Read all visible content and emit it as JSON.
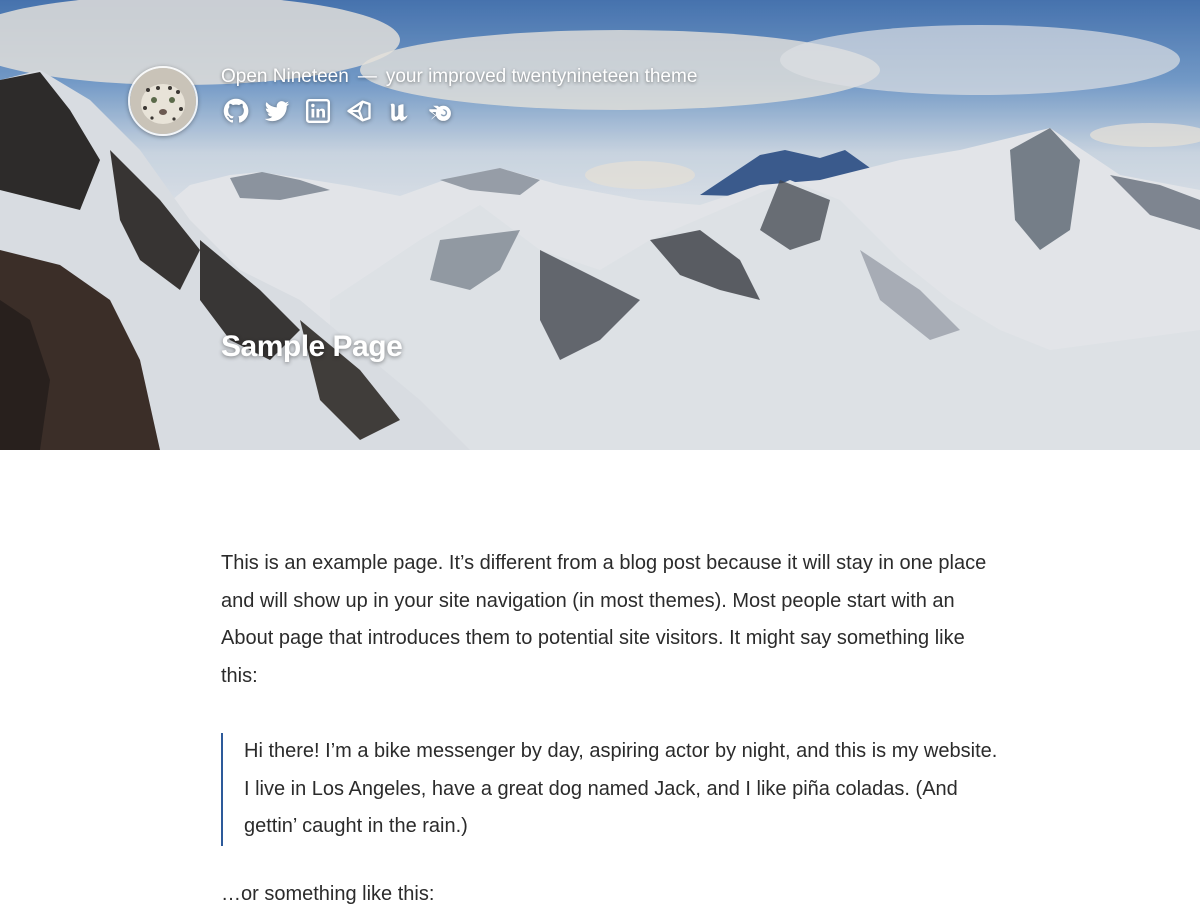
{
  "header": {
    "site_title": "Open Nineteen",
    "separator": "—",
    "tagline": "your improved twentynineteen theme",
    "avatar_icon": "snow-leopard-avatar",
    "social_links": [
      {
        "name": "github-icon"
      },
      {
        "name": "twitter-icon"
      },
      {
        "name": "linkedin-icon"
      },
      {
        "name": "unity-icon"
      },
      {
        "name": "unreal-engine-icon"
      },
      {
        "name": "blender-icon"
      }
    ]
  },
  "page": {
    "title": "Sample Page"
  },
  "content": {
    "paragraph1": "This is an example page. It’s different from a blog post because it will stay in one place and will show up in your site navigation (in most themes). Most people start with an About page that introduces them to potential site visitors. It might say something like this:",
    "quote": "Hi there! I’m a bike messenger by day, aspiring actor by night, and this is my website. I live in Los Angeles, have a great dog named Jack, and I like piña coladas. (And gettin’ caught in the rain.)",
    "paragraph2": "…or something like this:"
  }
}
